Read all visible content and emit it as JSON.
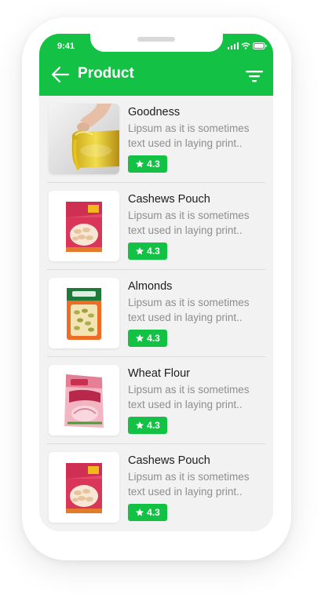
{
  "status_bar": {
    "time": "9:41"
  },
  "header": {
    "title": "Product",
    "back_icon": "arrow-left-icon",
    "filter_icon": "filter-icon"
  },
  "colors": {
    "accent": "#13c244",
    "background": "#f2f2f2"
  },
  "products": [
    {
      "name": "Goodness",
      "description": "Lipsum as it is sometimes text used in laying print..",
      "rating": "4.3",
      "image": "olive-oil"
    },
    {
      "name": "Cashews Pouch",
      "description": "Lipsum as it is sometimes text used in laying print..",
      "rating": "4.3",
      "image": "cashews-pouch"
    },
    {
      "name": "Almonds",
      "description": "Lipsum as it is sometimes text used in laying print..",
      "rating": "4.3",
      "image": "almonds-pack"
    },
    {
      "name": "Wheat Flour",
      "description": "Lipsum as it is sometimes text used in laying print..",
      "rating": "4.3",
      "image": "atta-pack"
    },
    {
      "name": "Cashews Pouch",
      "description": "Lipsum as it is sometimes text used in laying print..",
      "rating": "4.3",
      "image": "cashews-pouch"
    }
  ]
}
